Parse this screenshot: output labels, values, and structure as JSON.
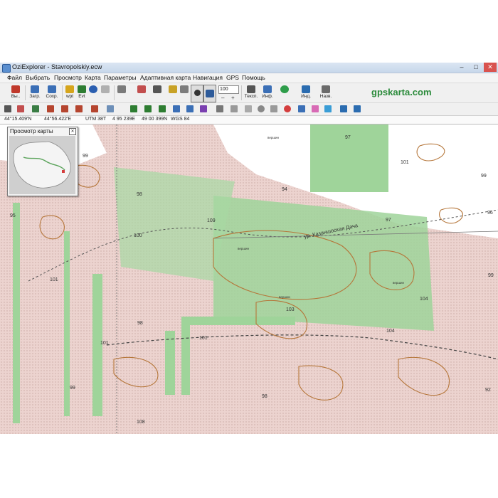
{
  "window": {
    "title": "OziExplorer - Stavropolskiy.ecw",
    "controls": {
      "minimize": "–",
      "maximize": "□",
      "close": "✕"
    }
  },
  "menu": [
    "Файл",
    "Выбрать",
    "Просмотр",
    "Карта",
    "Параметры",
    "Адаптивная карта",
    "Навигация",
    "GPS",
    "Помощь"
  ],
  "toolbar": {
    "buttons": [
      {
        "label": "Вы..",
        "icon": "exit-icon",
        "color": "#c0392b"
      },
      {
        "label": "Загр.",
        "icon": "load-icon",
        "color": "#3b6fb6"
      },
      {
        "label": "Сохр.",
        "icon": "save-icon",
        "color": "#3b6fb6"
      },
      {
        "label": "wpt",
        "icon": "waypoint-icon",
        "color": "#d6a51c"
      },
      {
        "label": "Evt",
        "icon": "event-icon",
        "color": "#2e7d32"
      },
      {
        "label": "Тексп.",
        "icon": "text-icon",
        "color": "#555555"
      },
      {
        "label": "Инф.",
        "icon": "info-icon",
        "color": "#3b6fb6"
      },
      {
        "label": "Инд.",
        "icon": "index-icon",
        "color": "#2b6cb0"
      },
      {
        "label": "Назв.",
        "icon": "names-icon",
        "color": "#6b6b6b"
      }
    ],
    "zoom_value": "100",
    "zoom_plus": "+",
    "zoom_minus": "–"
  },
  "brand": "gpskarta.com",
  "statusbar": {
    "lat": "44°15.409'N",
    "lon": "44°56.422'E",
    "utm": "UTM 38T",
    "easting": "4 95 239E",
    "northing": "49 00 399N",
    "datum": "WGS 84"
  },
  "overview": {
    "title": "Просмотр карты",
    "close": "✕"
  },
  "map": {
    "colors": {
      "forest": "#9fd49a",
      "field": "#f2d9d6",
      "contour": "#b5763a",
      "road": "#333333"
    },
    "labels": [
      "97",
      "101",
      "99",
      "95",
      "98",
      "100",
      "109",
      "94",
      "97",
      "96",
      "99",
      "101",
      "98",
      "104",
      "103",
      "104",
      "98",
      "101",
      "99",
      "98",
      "108",
      "101",
      "99",
      "92"
    ],
    "street": "ур. Казаншоcкая Дача",
    "markers": [
      "вершин",
      "вершин",
      "вершин",
      "вершин"
    ]
  }
}
